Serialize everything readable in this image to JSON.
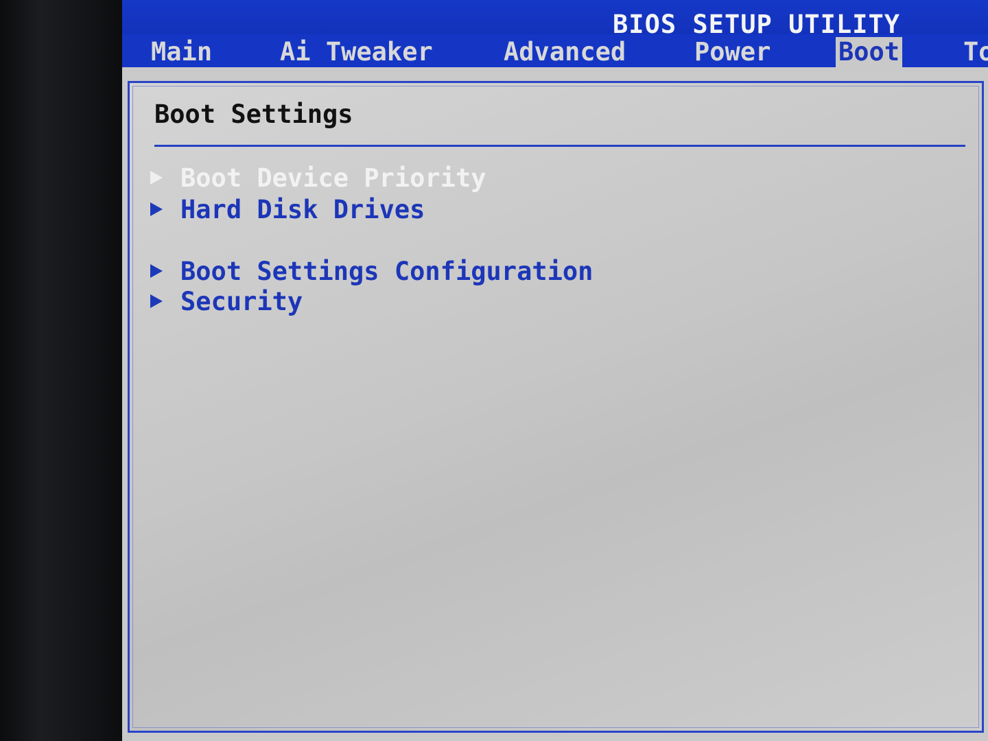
{
  "header": {
    "title": "BIOS SETUP UTILITY"
  },
  "tabs": [
    {
      "label": "Main"
    },
    {
      "label": "Ai Tweaker"
    },
    {
      "label": "Advanced"
    },
    {
      "label": "Power"
    },
    {
      "label": "Boot"
    },
    {
      "label": "To"
    }
  ],
  "active_tab": "Boot",
  "panel": {
    "title": "Boot Settings",
    "items": [
      {
        "label": "Boot Device Priority",
        "selected": true
      },
      {
        "label": "Hard Disk Drives",
        "selected": false
      },
      {
        "label": "Boot Settings Configuration",
        "selected": false
      },
      {
        "label": "Security",
        "selected": false
      }
    ]
  },
  "colors": {
    "title_bar": "#1638c8",
    "panel_background": "#c9c9c9",
    "item_text": "#1c36b8",
    "selected_item_text": "#f2f2f2"
  },
  "icons": {
    "submenu": "triangle-right-icon"
  }
}
